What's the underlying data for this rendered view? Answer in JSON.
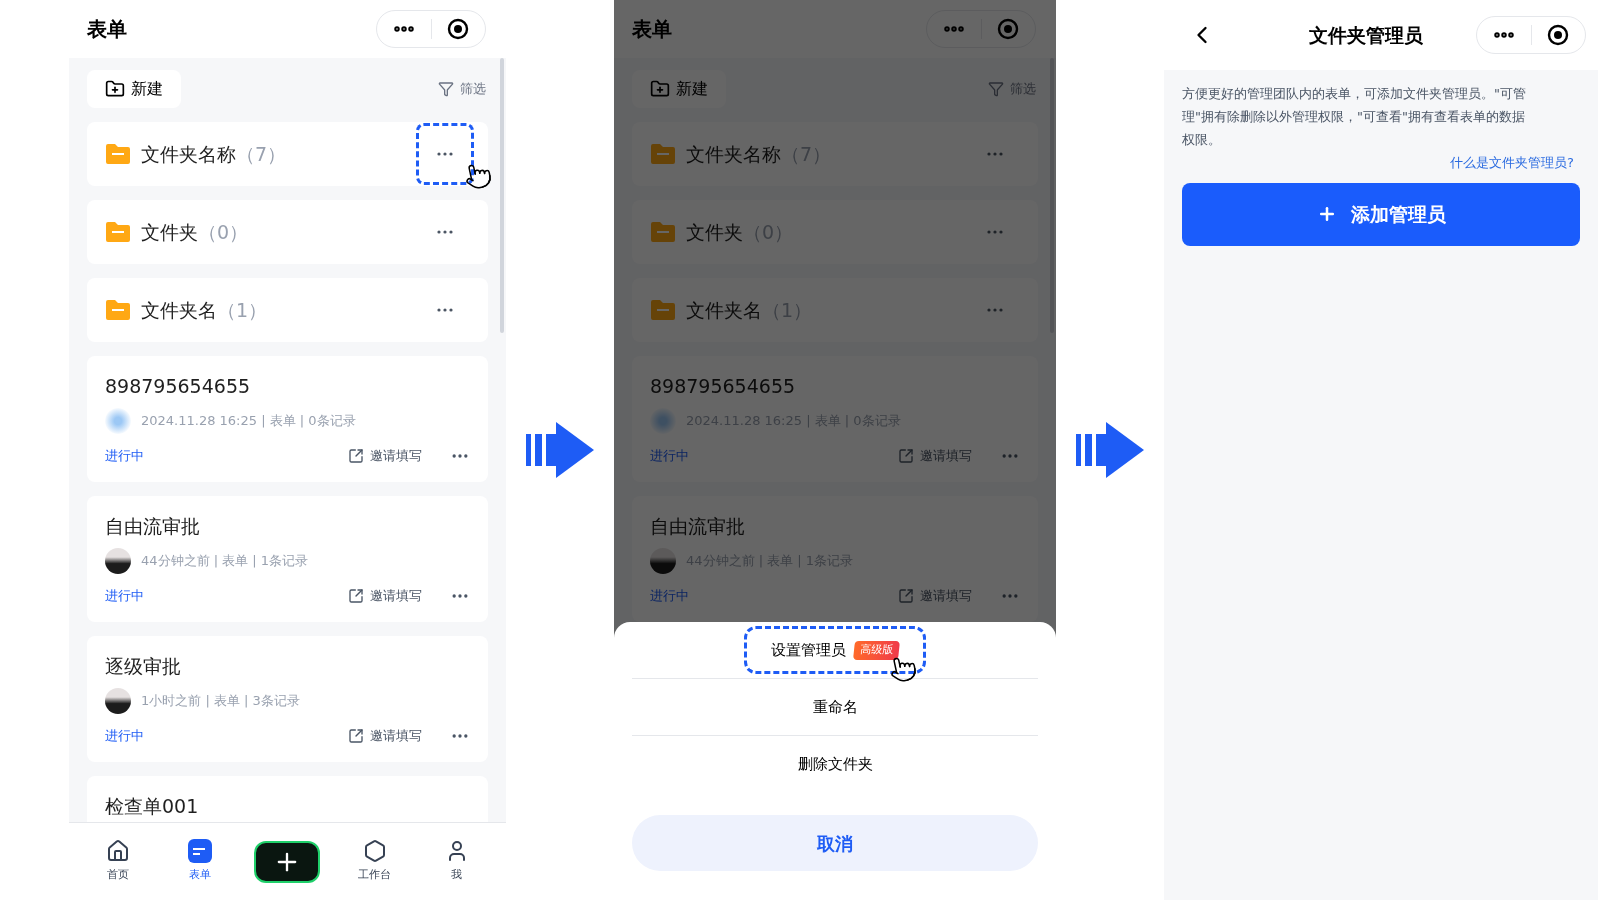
{
  "screen_list": {
    "title": "表单",
    "new_button": "新建",
    "filter": "筛选",
    "folders": [
      {
        "name": "文件夹名称",
        "count": "（7）",
        "highlighted": true
      },
      {
        "name": "文件夹",
        "count": "（0）",
        "highlighted": false
      },
      {
        "name": "文件夹名",
        "count": "（1）",
        "highlighted": false
      }
    ],
    "forms": [
      {
        "name": "898795654655",
        "kind": "blur",
        "meta": "2024.11.28 16:25 | 表单 | 0条记录",
        "status": "进行中",
        "invite": "邀请填写"
      },
      {
        "name": "自由流审批",
        "kind": "photo",
        "meta": "44分钟之前 | 表单 | 1条记录",
        "status": "进行中",
        "invite": "邀请填写"
      },
      {
        "name": "逐级审批",
        "kind": "photo",
        "meta": "1小时之前 | 表单 | 3条记录",
        "status": "进行中",
        "invite": "邀请填写"
      },
      {
        "name": "检查单001"
      }
    ],
    "tabbar": [
      {
        "kind": "home",
        "label": "首页",
        "selected": false
      },
      {
        "kind": "forms",
        "label": "表单",
        "selected": true
      },
      {
        "kind": "add"
      },
      {
        "kind": "workbench",
        "label": "工作台",
        "selected": false
      },
      {
        "kind": "me",
        "label": "我",
        "selected": false
      }
    ]
  },
  "screen_menu": {
    "title": "表单",
    "new_button": "新建",
    "filter": "筛选",
    "folders": [
      {
        "name": "文件夹名称",
        "count": "（7）",
        "highlighted": false
      },
      {
        "name": "文件夹",
        "count": "（0）",
        "highlighted": false
      },
      {
        "name": "文件夹名",
        "count": "（1）",
        "highlighted": false
      }
    ],
    "forms": [
      {
        "name": "898795654655",
        "kind": "blur",
        "meta": "2024.11.28 16:25 | 表单 | 0条记录",
        "status": "进行中",
        "invite": "邀请填写"
      },
      {
        "name": "自由流审批",
        "kind": "photo",
        "meta": "44分钟之前 | 表单 | 1条记录",
        "status": "进行中",
        "invite": "邀请填写"
      }
    ],
    "sheet": {
      "items": [
        {
          "label": "设置管理员",
          "badge": "高级版",
          "highlighted": true
        },
        {
          "label": "重命名",
          "highlighted": false
        },
        {
          "label": "删除文件夹",
          "highlighted": false
        }
      ],
      "cancel": "取消"
    }
  },
  "screen_admin": {
    "title": "文件夹管理员",
    "description": "方便更好的管理团队内的表单，可添加文件夹管理员。\"可管理\"拥有除删除以外管理权限，\"可查看\"拥有查看表单的数据权限。",
    "help_link": "什么是文件夹管理员?",
    "add_button": "添加管理员"
  }
}
